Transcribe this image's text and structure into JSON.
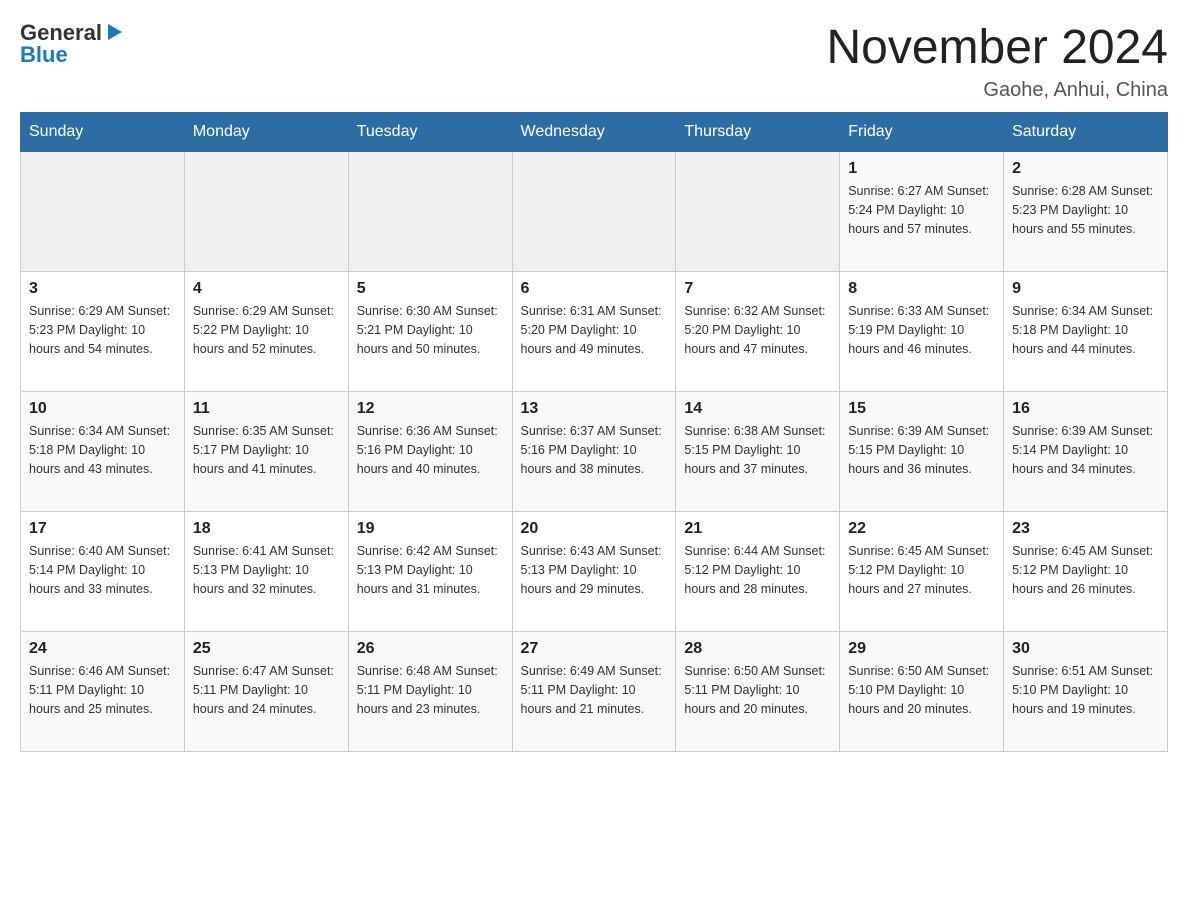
{
  "header": {
    "logo_general": "General",
    "logo_blue": "Blue",
    "month_title": "November 2024",
    "location": "Gaohe, Anhui, China"
  },
  "days_of_week": [
    "Sunday",
    "Monday",
    "Tuesday",
    "Wednesday",
    "Thursday",
    "Friday",
    "Saturday"
  ],
  "weeks": [
    [
      {
        "day": "",
        "info": ""
      },
      {
        "day": "",
        "info": ""
      },
      {
        "day": "",
        "info": ""
      },
      {
        "day": "",
        "info": ""
      },
      {
        "day": "",
        "info": ""
      },
      {
        "day": "1",
        "info": "Sunrise: 6:27 AM\nSunset: 5:24 PM\nDaylight: 10 hours and 57 minutes."
      },
      {
        "day": "2",
        "info": "Sunrise: 6:28 AM\nSunset: 5:23 PM\nDaylight: 10 hours and 55 minutes."
      }
    ],
    [
      {
        "day": "3",
        "info": "Sunrise: 6:29 AM\nSunset: 5:23 PM\nDaylight: 10 hours and 54 minutes."
      },
      {
        "day": "4",
        "info": "Sunrise: 6:29 AM\nSunset: 5:22 PM\nDaylight: 10 hours and 52 minutes."
      },
      {
        "day": "5",
        "info": "Sunrise: 6:30 AM\nSunset: 5:21 PM\nDaylight: 10 hours and 50 minutes."
      },
      {
        "day": "6",
        "info": "Sunrise: 6:31 AM\nSunset: 5:20 PM\nDaylight: 10 hours and 49 minutes."
      },
      {
        "day": "7",
        "info": "Sunrise: 6:32 AM\nSunset: 5:20 PM\nDaylight: 10 hours and 47 minutes."
      },
      {
        "day": "8",
        "info": "Sunrise: 6:33 AM\nSunset: 5:19 PM\nDaylight: 10 hours and 46 minutes."
      },
      {
        "day": "9",
        "info": "Sunrise: 6:34 AM\nSunset: 5:18 PM\nDaylight: 10 hours and 44 minutes."
      }
    ],
    [
      {
        "day": "10",
        "info": "Sunrise: 6:34 AM\nSunset: 5:18 PM\nDaylight: 10 hours and 43 minutes."
      },
      {
        "day": "11",
        "info": "Sunrise: 6:35 AM\nSunset: 5:17 PM\nDaylight: 10 hours and 41 minutes."
      },
      {
        "day": "12",
        "info": "Sunrise: 6:36 AM\nSunset: 5:16 PM\nDaylight: 10 hours and 40 minutes."
      },
      {
        "day": "13",
        "info": "Sunrise: 6:37 AM\nSunset: 5:16 PM\nDaylight: 10 hours and 38 minutes."
      },
      {
        "day": "14",
        "info": "Sunrise: 6:38 AM\nSunset: 5:15 PM\nDaylight: 10 hours and 37 minutes."
      },
      {
        "day": "15",
        "info": "Sunrise: 6:39 AM\nSunset: 5:15 PM\nDaylight: 10 hours and 36 minutes."
      },
      {
        "day": "16",
        "info": "Sunrise: 6:39 AM\nSunset: 5:14 PM\nDaylight: 10 hours and 34 minutes."
      }
    ],
    [
      {
        "day": "17",
        "info": "Sunrise: 6:40 AM\nSunset: 5:14 PM\nDaylight: 10 hours and 33 minutes."
      },
      {
        "day": "18",
        "info": "Sunrise: 6:41 AM\nSunset: 5:13 PM\nDaylight: 10 hours and 32 minutes."
      },
      {
        "day": "19",
        "info": "Sunrise: 6:42 AM\nSunset: 5:13 PM\nDaylight: 10 hours and 31 minutes."
      },
      {
        "day": "20",
        "info": "Sunrise: 6:43 AM\nSunset: 5:13 PM\nDaylight: 10 hours and 29 minutes."
      },
      {
        "day": "21",
        "info": "Sunrise: 6:44 AM\nSunset: 5:12 PM\nDaylight: 10 hours and 28 minutes."
      },
      {
        "day": "22",
        "info": "Sunrise: 6:45 AM\nSunset: 5:12 PM\nDaylight: 10 hours and 27 minutes."
      },
      {
        "day": "23",
        "info": "Sunrise: 6:45 AM\nSunset: 5:12 PM\nDaylight: 10 hours and 26 minutes."
      }
    ],
    [
      {
        "day": "24",
        "info": "Sunrise: 6:46 AM\nSunset: 5:11 PM\nDaylight: 10 hours and 25 minutes."
      },
      {
        "day": "25",
        "info": "Sunrise: 6:47 AM\nSunset: 5:11 PM\nDaylight: 10 hours and 24 minutes."
      },
      {
        "day": "26",
        "info": "Sunrise: 6:48 AM\nSunset: 5:11 PM\nDaylight: 10 hours and 23 minutes."
      },
      {
        "day": "27",
        "info": "Sunrise: 6:49 AM\nSunset: 5:11 PM\nDaylight: 10 hours and 21 minutes."
      },
      {
        "day": "28",
        "info": "Sunrise: 6:50 AM\nSunset: 5:11 PM\nDaylight: 10 hours and 20 minutes."
      },
      {
        "day": "29",
        "info": "Sunrise: 6:50 AM\nSunset: 5:10 PM\nDaylight: 10 hours and 20 minutes."
      },
      {
        "day": "30",
        "info": "Sunrise: 6:51 AM\nSunset: 5:10 PM\nDaylight: 10 hours and 19 minutes."
      }
    ]
  ]
}
